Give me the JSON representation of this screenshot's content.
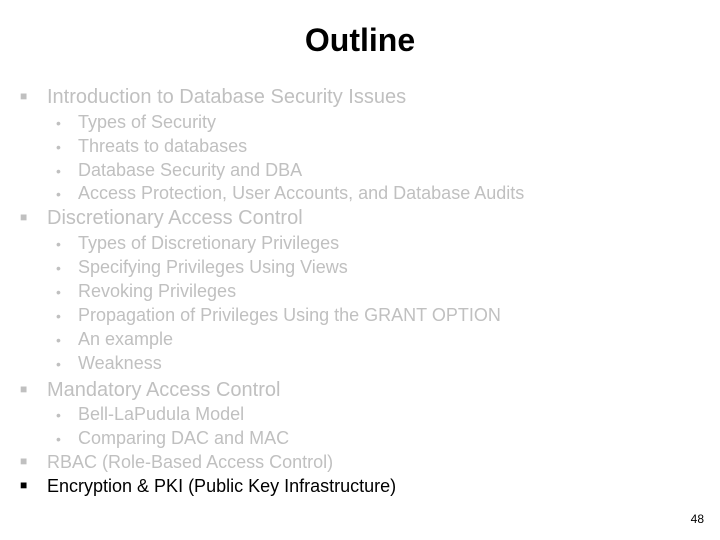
{
  "slide": {
    "title": "Outline",
    "page_number": "48",
    "bullet_level1": "■",
    "bullet_level2": "•",
    "colors": {
      "dimmed_text": "#c0c0c0",
      "active_text": "#000000"
    }
  },
  "outline": [
    {
      "label": "Introduction to Database Security Issues",
      "active": false,
      "children": [
        "Types of Security",
        "Threats to databases",
        "Database Security and DBA",
        "Access Protection, User Accounts, and Database Audits"
      ]
    },
    {
      "label": "Discretionary Access Control",
      "active": false,
      "children": [
        "Types of Discretionary Privileges",
        "Specifying Privileges Using Views",
        "Revoking Privileges",
        "Propagation of Privileges Using the GRANT OPTION",
        "An example",
        "Weakness"
      ]
    },
    {
      "label": "Mandatory Access Control",
      "active": false,
      "children": [
        "Bell-LaPudula Model",
        "Comparing DAC and MAC"
      ]
    },
    {
      "label": "RBAC (Role-Based Access Control)",
      "active": false,
      "children": []
    },
    {
      "label": "Encryption & PKI (Public Key Infrastructure)",
      "active": true,
      "children": []
    }
  ]
}
